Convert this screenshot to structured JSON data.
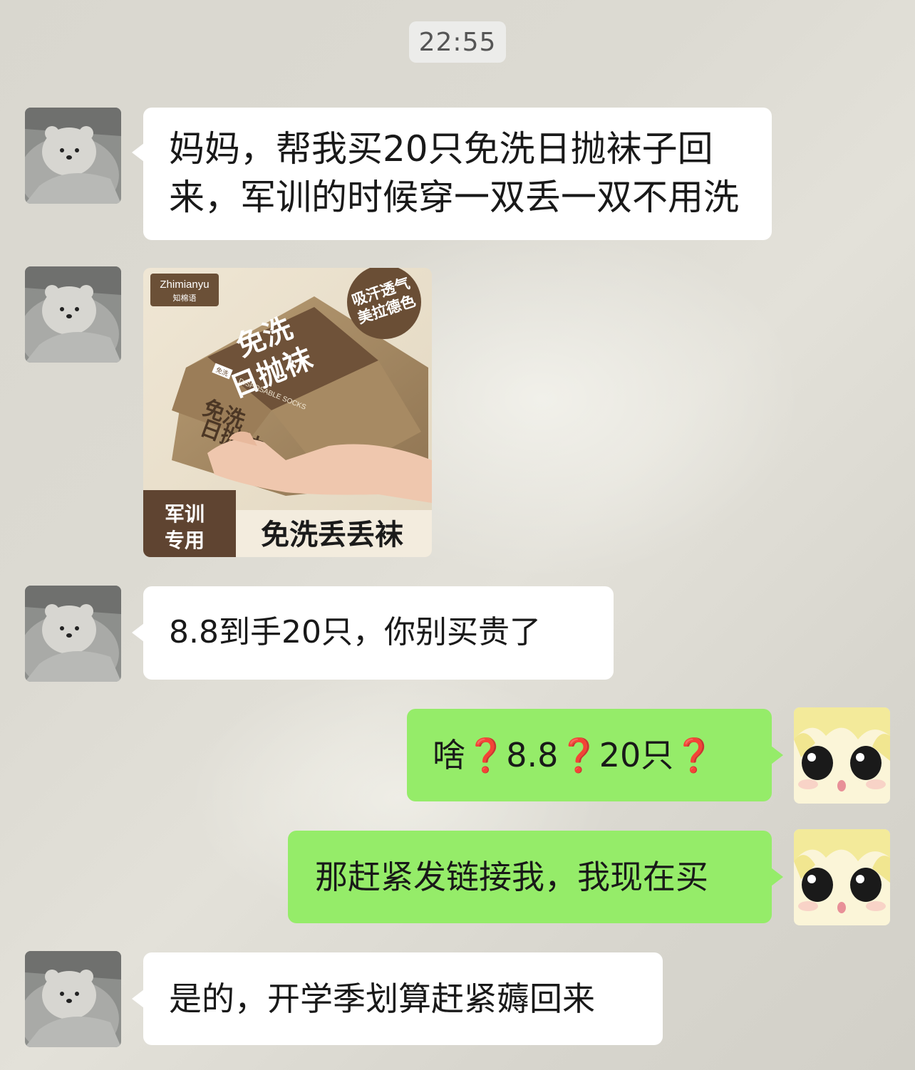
{
  "timestamp": "22:55",
  "messages": [
    {
      "side": "left",
      "type": "text",
      "lines": [
        "妈妈，帮我买20只免洗日抛袜子回",
        "来，军训的时候穿一双丢一双不用洗"
      ]
    },
    {
      "side": "left",
      "type": "image",
      "product": {
        "brand": "Zhimianyu",
        "brand_cn": "知棉语",
        "title_line1": "免洗",
        "title_line2": "日抛袜",
        "badge_line1": "吸汗透气",
        "badge_line2": "美拉德色",
        "tag": "免洗",
        "english": "DISPOSABLE SOCKS",
        "back_text": "免洗",
        "back_text2": "日抛袜",
        "corner_line1": "军训",
        "corner_line2": "专用",
        "bottom_label": "免洗丢丢袜"
      }
    },
    {
      "side": "left",
      "type": "text",
      "text": "8.8到手20只，你别买贵了"
    },
    {
      "side": "right",
      "type": "text",
      "parts": [
        "啥",
        "❓",
        "8.8",
        "❓",
        "20只",
        "❓"
      ]
    },
    {
      "side": "right",
      "type": "text",
      "text": "那赶紧发链接我，我现在买"
    },
    {
      "side": "left",
      "type": "text",
      "text": "是的，开学季划算赶紧薅回来"
    }
  ],
  "colors": {
    "left_bubble": "#ffffff",
    "right_bubble": "#95ec69",
    "question_mark": "#e0352b",
    "product_brown": "#7a5a3e",
    "product_kraft": "#a68a64"
  },
  "icons": {
    "mom_avatar": "bear-blanket-avatar",
    "user_avatar": "cartoon-face-avatar"
  }
}
